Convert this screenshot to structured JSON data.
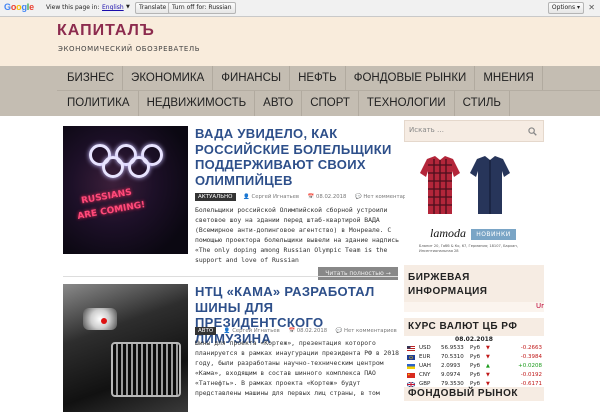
{
  "translate_bar": {
    "logo": "Google",
    "label": "View this page in:",
    "language": "English",
    "translate_button": "Translate",
    "turnoff_button": "Turn off for: Russian",
    "options_label": "Options ▾",
    "close": "✕"
  },
  "site": {
    "title": "КАПИТАЛЪ",
    "description": "ЭКОНОМИЧЕСКИЙ ОБОЗРЕВАТЕЛЬ"
  },
  "nav": {
    "row1": [
      "БИЗНЕС",
      "ЭКОНОМИКА",
      "ФИНАНСЫ",
      "НЕФТЬ",
      "ФОНДОВЫЕ РЫНКИ",
      "МНЕНИЯ"
    ],
    "row2": [
      "ПОЛИТИКА",
      "НЕДВИЖИМОСТЬ",
      "АВТО",
      "СПОРТ",
      "ТЕХНОЛОГИИ",
      "СТИЛЬ"
    ]
  },
  "posts": [
    {
      "title": "ВАДА УВИДЕЛО, КАК РОССИЙСКИЕ БОЛЕЛЬЩИКИ ПОДДЕРЖИВАЮТ СВОИХ ОЛИМПИЙЦЕВ",
      "category": "АКТУАЛЬНО",
      "author": "Сергей Игнатьев",
      "date": "08.02.2018",
      "comments": "Нет комментариев",
      "excerpt": "Болельщики российской Олимпийской сборной устроили световое шоу на здании перед штаб-квартирой ВАДА (Всемирное анти-допинговое агентство) в Монреале.  С помощью проектора болельщики вывели на здание надпись «The only doping among Russian Olympic Team is the support and love of Russian",
      "read_more": "Читать полностью →",
      "image_text_1": "RUSSIANS",
      "image_text_2": "ARE COMING!"
    },
    {
      "title": "НТЦ «КАМА» РАЗРАБОТАЛ ШИНЫ ДЛЯ ПРЕЗИДЕНТСКОГО ЛИМУЗИНА",
      "category": "АВТО",
      "author": "Сергей Игнатьев",
      "date": "08.02.2018",
      "comments": "Нет комментариев",
      "excerpt": "Шины для проекта «Кортеж», презентация которого планируется в рамках инаугурации президента РФ в 2018 году, были разработаны научно-техническим центром «Кама», входящим в состав шинного комплекса ПАО «Татнефть». В рамках проекта «Кортеж» будут представлены машины для первых лиц страны, в том"
    }
  ],
  "sidebar": {
    "search_placeholder": "Искать …",
    "ad": {
      "brand": "lamoda",
      "badge": "НОВИНКИ",
      "small_text": "Бланит 20, Габб & Ко, 67, Германия; 18107, Бархан, Инсентиональная 28"
    },
    "widget1_title": "БИРЖЕВАЯ ИНФОРМАЦИЯ",
    "ticker": "Ur",
    "widget2_title": "КУРС ВАЛЮТ ЦБ РФ",
    "currency_date": "08.02.2018",
    "rates": [
      {
        "code": "USD",
        "value": "56.9533",
        "unit": "Руб",
        "dir": "down",
        "arrow": "▼",
        "change": "-0.2663"
      },
      {
        "code": "EUR",
        "value": "70.5310",
        "unit": "Руб",
        "dir": "down",
        "arrow": "▼",
        "change": "-0.3984"
      },
      {
        "code": "UAH",
        "value": "2.0993",
        "unit": "Руб",
        "dir": "up",
        "arrow": "▲",
        "change": "+0.0208"
      },
      {
        "code": "CNY",
        "value": "9.0974",
        "unit": "Руб",
        "dir": "down",
        "arrow": "▼",
        "change": "-0.0192"
      },
      {
        "code": "GBP",
        "value": "79.3530",
        "unit": "Руб",
        "dir": "down",
        "arrow": "▼",
        "change": "-0.6171"
      }
    ],
    "widget3_title": "ФОНДОВЫЙ РЫНОК"
  },
  "colors": {
    "brand": "#8c2b4e",
    "title_link": "#2d4f8a",
    "header_bg": "#f9ecdc",
    "nav_bg": "#c4bdb2"
  }
}
